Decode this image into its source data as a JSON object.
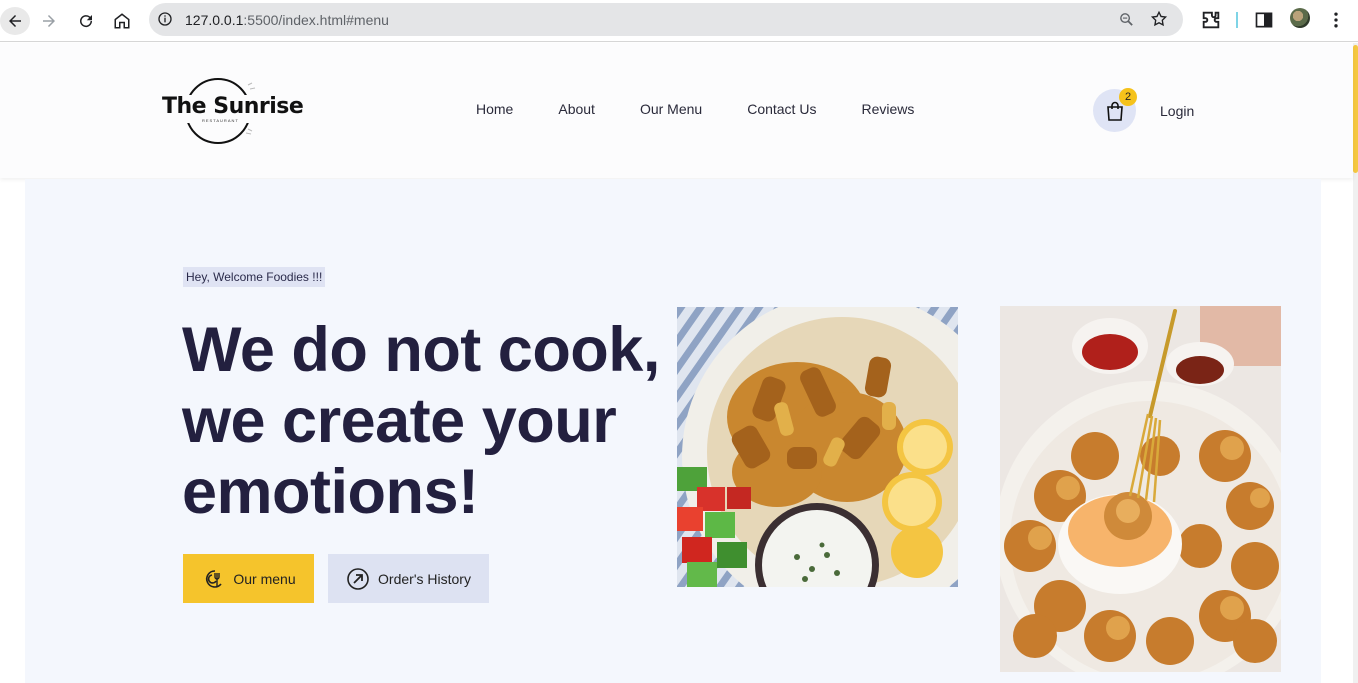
{
  "browser": {
    "url_host": "127.0.0.1",
    "url_rest": ":5500/index.html#menu"
  },
  "nav": {
    "logo_text": "The Sunrise",
    "logo_sub": "RESTAURANT",
    "links": [
      "Home",
      "About",
      "Our Menu",
      "Contact Us",
      "Reviews"
    ],
    "cart_count": "2",
    "login": "Login"
  },
  "hero": {
    "welcome": "Hey, Welcome Foodies !!!",
    "headline": "We do not cook, we create your emotions!",
    "menu_button": "Our menu",
    "history_button": "Order's History"
  },
  "colors": {
    "accent_yellow": "#f5c42c",
    "headline": "#23203f",
    "hero_bg": "#f4f7fd",
    "secondary_btn": "#dde2f2"
  },
  "icons": {
    "back": "arrow-left-icon",
    "forward": "arrow-right-icon",
    "reload": "reload-icon",
    "home": "home-icon",
    "info": "info-icon",
    "zoom": "zoom-icon",
    "bookmark": "star-icon",
    "extensions": "puzzle-icon",
    "sidepanel": "side-panel-icon",
    "menu": "kebab-menu-icon",
    "cart": "shopping-bag-icon",
    "menu_button": "restaurant-icon",
    "history_button": "arrow-up-right-circle-icon"
  }
}
